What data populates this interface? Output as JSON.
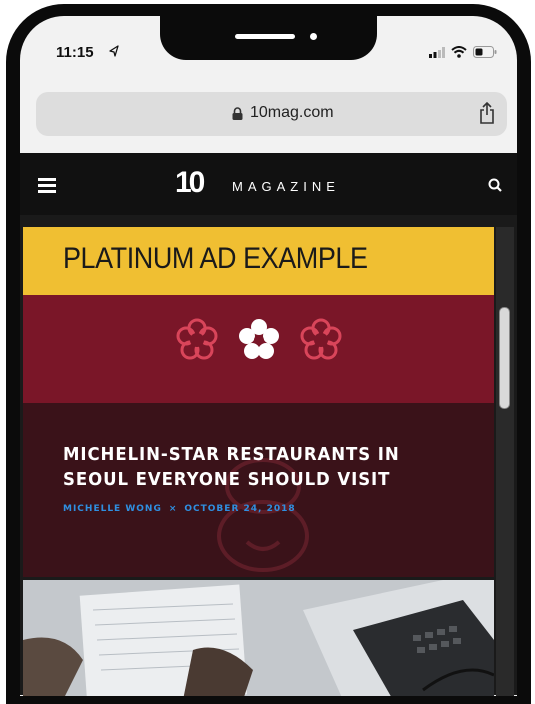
{
  "status_bar": {
    "time": "11:15",
    "location_icon": "location-arrow-icon",
    "signal_icon": "signal-icon",
    "wifi_icon": "wifi-icon",
    "battery_icon": "battery-icon"
  },
  "browser": {
    "url": "10mag.com",
    "lock_icon": "lock-icon",
    "share_icon": "share-icon"
  },
  "site_header": {
    "logo_number": "10",
    "logo_word": "MAGAZINE",
    "menu_icon": "hamburger-menu-icon",
    "search_icon": "search-icon"
  },
  "ad_banner": {
    "label": "PLATINUM AD EXAMPLE",
    "color": "#f0bf32"
  },
  "feature": {
    "headline": "MICHELIN-STAR RESTAURANTS IN SEOUL EVERYONE SHOULD VISIT",
    "author": "MICHELLE WONG",
    "separator": "×",
    "date": "OCTOBER 24, 2018",
    "background": "#7a1628",
    "star_icons": [
      "michelin-star-icon",
      "michelin-star-icon",
      "michelin-star-icon"
    ]
  }
}
